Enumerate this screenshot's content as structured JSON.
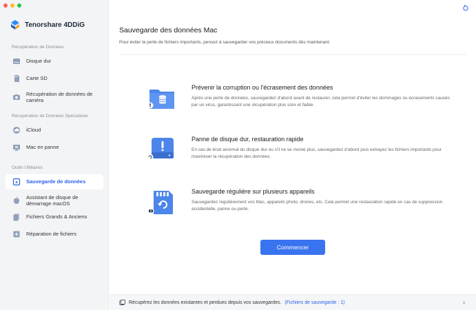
{
  "app": {
    "brand": "Tenorshare 4DDiG",
    "window_controls": {
      "close": "#ff5f57",
      "minimize": "#febc2e",
      "maximize": "#28c840"
    }
  },
  "sidebar": {
    "sections": [
      {
        "title": "Récupération de Données",
        "items": [
          {
            "label": "Disque dur",
            "icon": "hard-drive-icon"
          },
          {
            "label": "Carte SD",
            "icon": "sd-card-icon"
          },
          {
            "label": "Récupération de données de caméra",
            "icon": "camera-icon"
          }
        ]
      },
      {
        "title": "Récupération de Données Spécialisée",
        "items": [
          {
            "label": "iCloud",
            "icon": "cloud-icon"
          },
          {
            "label": "Mac en panne",
            "icon": "crashed-mac-icon"
          }
        ]
      },
      {
        "title": "Outils Utilitaires",
        "items": [
          {
            "label": "Sauvegarde de données",
            "icon": "backup-icon",
            "active": true
          },
          {
            "label": "Assistant de disque de démarrage macOS",
            "icon": "apple-icon"
          },
          {
            "label": "Fichiers Grands & Anciens",
            "icon": "files-icon"
          },
          {
            "label": "Réparation de fichiers",
            "icon": "repair-icon"
          }
        ]
      }
    ]
  },
  "main": {
    "title": "Sauvegarde des données Mac",
    "subtitle": "Pour éviter la perte de fichiers importants, pensez à sauvegarder vos précieux documents dès maintenant.",
    "features": [
      {
        "title": "Prévenir la corruption ou l'écrasement des données",
        "description": "Après une perte de données, sauvegardez d'abord avant de restaurer, cela permet d'éviter les dommages ou écrasements causés par un virus, garantissant une récupération plus sûre et fiable.",
        "icon": "folder-database-warning-icon"
      },
      {
        "title": "Panne de disque dur, restauration rapide",
        "description": "En cas de bruit anormal du disque dur ou s'il ne se monte plus, sauvegardez d'abord puis extrayez les fichiers importants pour maximiser la récupération des données.",
        "icon": "disk-failure-icon"
      },
      {
        "title": "Sauvegarde régulière sur plusieurs appareils",
        "description": "Sauvegardez régulièrement vos Mac, appareils photo, drones, etc. Cela permet une restauration rapide en cas de suppression accidentelle, panne ou perte.",
        "icon": "memory-card-backup-icon"
      }
    ],
    "start_button": "Commencer"
  },
  "footer": {
    "text": "Récupérez les données existantes et perdues depuis vos sauvegardes.",
    "link": "(Fichiers de sauvegarde : 1)"
  },
  "colors": {
    "accent": "#3a73f0",
    "active_text": "#2b61e6",
    "sidebar_bg": "#f3f4f6"
  }
}
